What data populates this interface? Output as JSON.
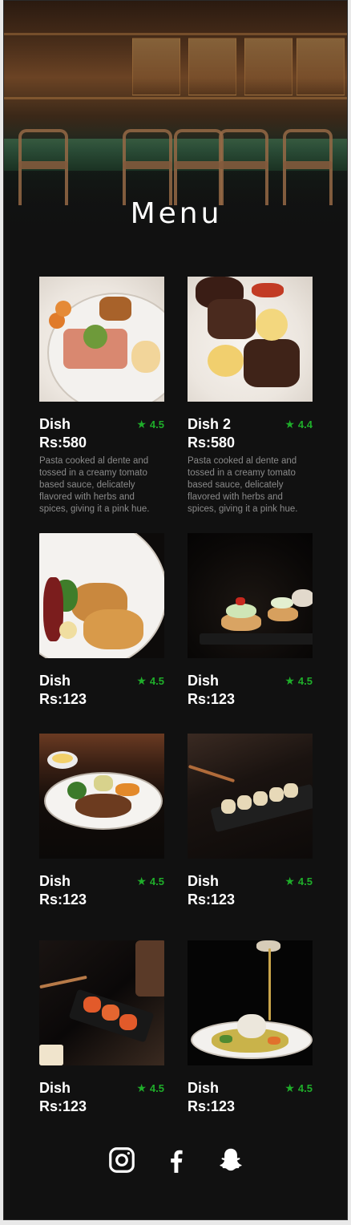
{
  "page": {
    "title": "Menu"
  },
  "colors": {
    "background": "#111111",
    "rating": "#1fae2a",
    "text": "#ffffff",
    "muted": "#8a8a8a"
  },
  "dishes": [
    {
      "name": "Dish",
      "rating": "4.5",
      "price": "Rs:580",
      "description": "Pasta cooked al dente and tossed in a creamy tomato based sauce, delicately flavored with herbs and spices, giving it a pink hue.",
      "image": "salmon-plate"
    },
    {
      "name": "Dish 2",
      "rating": "4.4",
      "price": "Rs:580",
      "description": "Pasta cooked al dente and tossed in a creamy tomato based sauce, delicately flavored with herbs and spices, giving it a pink hue.",
      "image": "steak-plate"
    },
    {
      "name": "Dish",
      "rating": "4.5",
      "price": "Rs:123",
      "image": "roast-chicken-plate"
    },
    {
      "name": "Dish",
      "rating": "4.5",
      "price": "Rs:123",
      "image": "canape-bites"
    },
    {
      "name": "Dish",
      "rating": "4.5",
      "price": "Rs:123",
      "image": "steak-with-sauce"
    },
    {
      "name": "Dish",
      "rating": "4.5",
      "price": "Rs:123",
      "image": "sushi-rolls"
    },
    {
      "name": "Dish",
      "rating": "4.5",
      "price": "Rs:123",
      "image": "sushi-platter"
    },
    {
      "name": "Dish",
      "rating": "4.5",
      "price": "Rs:123",
      "image": "risotto-pour"
    }
  ],
  "social": [
    "instagram-icon",
    "facebook-icon",
    "snapchat-icon"
  ]
}
